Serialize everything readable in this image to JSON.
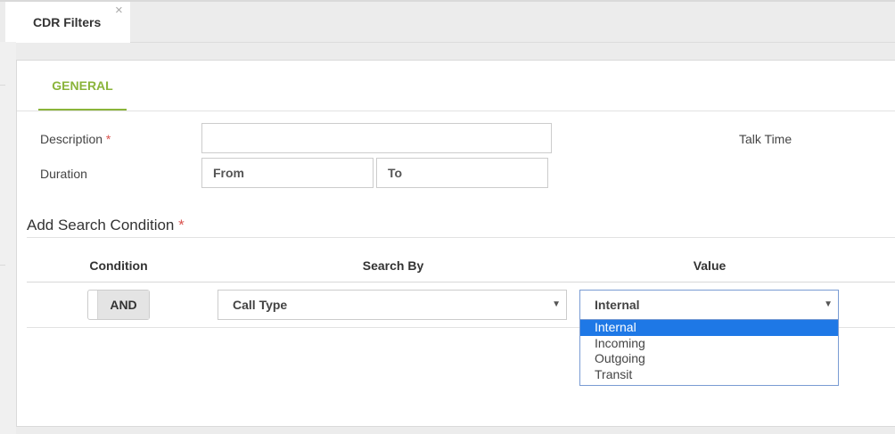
{
  "tabs": [
    {
      "label": "CDR Filters",
      "close": "×"
    }
  ],
  "subtabs": [
    {
      "label": "GENERAL"
    }
  ],
  "form": {
    "description_label": "Description",
    "required_mark": "*",
    "description_value": "",
    "duration_label": "Duration",
    "from_placeholder": "From",
    "to_placeholder": "To",
    "talk_time_label": "Talk Time"
  },
  "search_section": {
    "title": "Add Search Condition",
    "required_mark": "*",
    "columns": [
      "Condition",
      "Search By",
      "Value"
    ],
    "row": {
      "condition": "AND",
      "search_by": "Call Type",
      "value": "Internal",
      "arrow": "▼"
    },
    "value_options": [
      "Internal",
      "Incoming",
      "Outgoing",
      "Transit"
    ],
    "selected_option_index": 0
  },
  "colors": {
    "accent_green": "#8ab43a",
    "required_red": "#d9534f",
    "selection_blue": "#1e78e6"
  }
}
